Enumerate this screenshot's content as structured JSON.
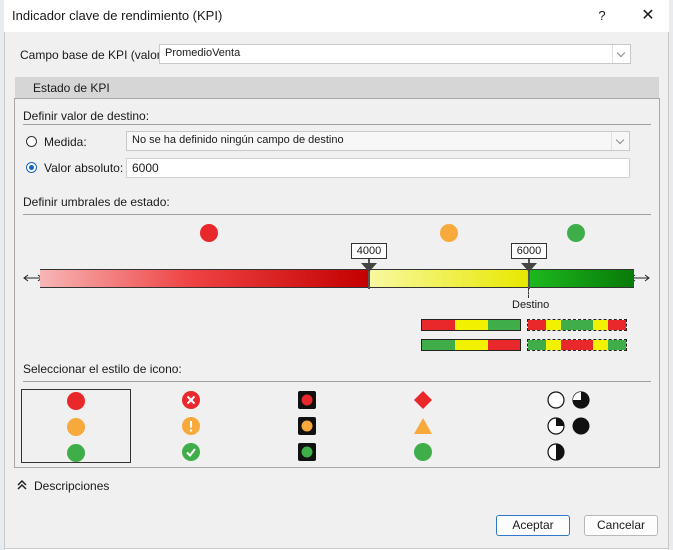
{
  "window": {
    "title": "Indicador clave de rendimiento (KPI)",
    "help": "?",
    "close": "✕"
  },
  "kpi_base": {
    "label": "Campo base de KPI (valor):",
    "value": "PromedioVenta"
  },
  "section": {
    "title": "Estado de KPI"
  },
  "target": {
    "heading": "Definir valor de destino:",
    "measure_label": "Medida:",
    "measure_value": "No se ha definido ningún campo de destino",
    "measure_selected": false,
    "absolute_label": "Valor absoluto:",
    "absolute_value": "6000",
    "absolute_selected": true
  },
  "thresholds": {
    "heading": "Definir umbrales de estado:",
    "threshold_low": "4000",
    "threshold_high": "6000",
    "target_label": "Destino",
    "status_colors": {
      "red": "#e8282b",
      "amber": "#f7a93b",
      "green": "#3fae49"
    }
  },
  "icon_style": {
    "heading": "Seleccionar el estilo de icono:",
    "selected_index": 0
  },
  "descriptions": {
    "label": "Descripciones"
  },
  "buttons": {
    "ok": "Aceptar",
    "cancel": "Cancelar"
  }
}
